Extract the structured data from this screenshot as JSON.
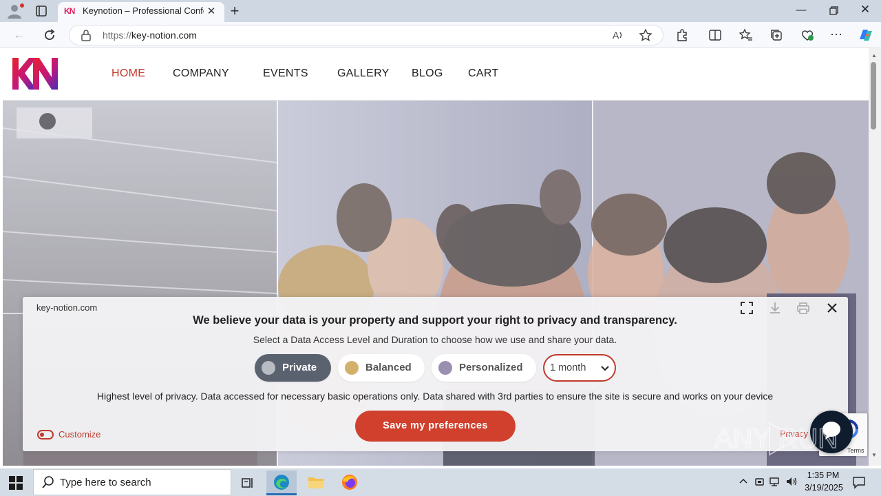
{
  "browser": {
    "tab_title": "Keynotion – Professional Confere",
    "tab_favicon": "KN",
    "url_protocol": "https://",
    "url_domain": "key-notion.com"
  },
  "site": {
    "logo": "KN",
    "nav": [
      "HOME",
      "COMPANY",
      "EVENTS",
      "GALLERY",
      "BLOG",
      "CART"
    ],
    "active_nav": "HOME"
  },
  "consent": {
    "domain": "key-notion.com",
    "heading": "We believe your data is your property and support your right to privacy and transparency.",
    "subheading": "Select a Data Access Level and Duration to choose how we use and share your data.",
    "levels": [
      {
        "label": "Private",
        "color": "#b9bcc2",
        "selected": true
      },
      {
        "label": "Balanced",
        "color": "#d4b16a",
        "selected": false
      },
      {
        "label": "Personalized",
        "color": "#9b8fb0",
        "selected": false
      }
    ],
    "duration": "1 month",
    "description": "Highest level of privacy. Data accessed for necessary basic operations only. Data shared with 3rd parties to ensure the site is secure and works on your device",
    "save_label": "Save my preferences",
    "customize_label": "Customize",
    "privacy_label": "Privacy"
  },
  "recaptcha": {
    "terms": "Terms"
  },
  "watermark": "ANY RUN",
  "taskbar": {
    "search_placeholder": "Type here to search",
    "time": "1:35 PM",
    "date": "3/19/2025"
  },
  "colors": {
    "brand_red": "#c0392b",
    "save_button": "#d0402d",
    "private_selected": "#5a6270"
  }
}
